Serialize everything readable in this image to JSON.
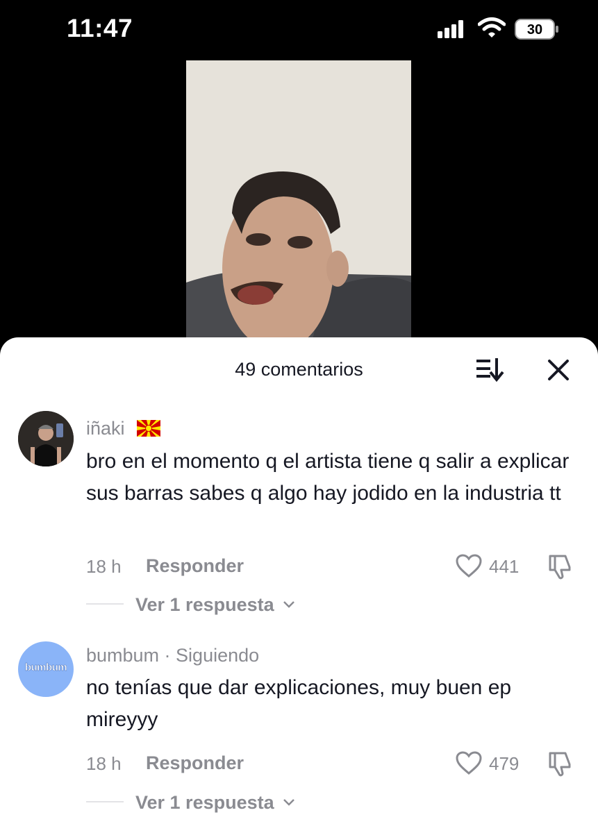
{
  "status_bar": {
    "time": "11:47",
    "battery": "30"
  },
  "comments_sheet": {
    "title": "49 comentarios",
    "comments": [
      {
        "username": "iñaki",
        "text": "bro en el momento q el artista tiene q salir a explicar sus barras sabes q algo hay jodido en la industria tt",
        "time": "18 h",
        "reply_label": "Responder",
        "likes": "441",
        "view_replies": "Ver 1 respuesta"
      },
      {
        "username": "bumbum · Siguiendo",
        "avatar_text": "bumbum",
        "text": "no tenías que dar explicaciones, muy buen ep mireyyy",
        "time": "18 h",
        "reply_label": "Responder",
        "likes": "479",
        "view_replies": "Ver 1 respuesta"
      }
    ]
  },
  "colors": {
    "accent_avatar": "#8ab4f8",
    "muted_text": "#8a8b91",
    "primary_text": "#161823"
  }
}
